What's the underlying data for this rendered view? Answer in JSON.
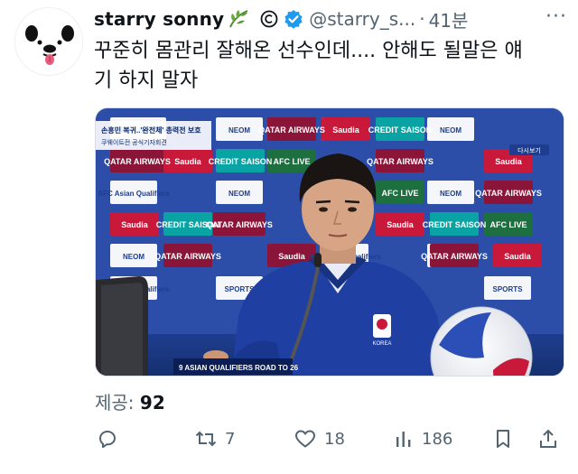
{
  "tweet": {
    "display_name": "starry sonny",
    "handle": "@starry_s...",
    "separator": "·",
    "time": "41분",
    "more_label": "···",
    "text_line1": "꾸준히 몸관리 잘해온 선수인데.... 안해도 될말은 얘",
    "text_line2": "기 하지 말자"
  },
  "media": {
    "video_banner": "손흥민 복귀..'완전체' 총력전 보호",
    "video_sub": "쿠웨이트전 공식기자회견",
    "corner_badge": "다시보기",
    "podium_text": "9 ASIAN QUALIFIERS ROAD TO 26",
    "board_sponsors": [
      "QATAR AIRWAYS",
      "Saudia",
      "NEOM",
      "CREDIT SAISON",
      "AFC LIVE",
      "AFC Asian Qualifiers",
      "SPORTS"
    ],
    "shirt_text": "KOREA"
  },
  "stats": {
    "views_label": "제공:",
    "views_value": "92",
    "reply_count": "",
    "repost_count": "7",
    "like_count": "18",
    "view_count": "186"
  },
  "icons": {
    "verified": "verified-badge-icon",
    "leaf": "leaf-emoji-icon",
    "copyright": "copyright-icon",
    "reply": "reply-icon",
    "repost": "repost-icon",
    "like": "heart-icon",
    "views": "views-bar-icon",
    "bookmark": "bookmark-icon",
    "share": "share-icon",
    "mute": "mute-icon"
  },
  "colors": {
    "text_primary": "#0f1419",
    "text_secondary": "#536471",
    "verified_blue": "#1d9bf0",
    "backdrop_blue": "#2d4ea8"
  }
}
